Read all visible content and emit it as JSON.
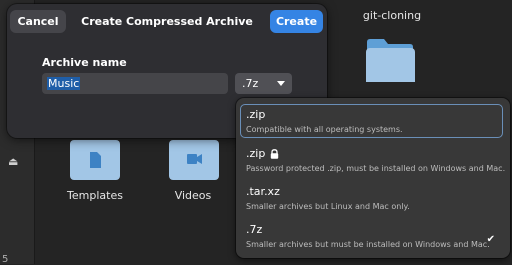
{
  "file_manager": {
    "items": [
      {
        "name": "git-cloning"
      },
      {
        "name": "Templates"
      },
      {
        "name": "Videos"
      }
    ],
    "eject_glyph": "⏏",
    "folder_color": "#a2c6e6",
    "folder_tab_color": "#5e9fd6"
  },
  "dialog": {
    "title": "Create Compressed Archive",
    "cancel_label": "Cancel",
    "create_label": "Create",
    "archive_name_label": "Archive name",
    "archive_name_value": "Music",
    "format_selected": ".7z"
  },
  "format_popover": {
    "options": [
      {
        "name": ".zip",
        "description": "Compatible with all operating systems.",
        "locked": false,
        "checked": false,
        "focused": true
      },
      {
        "name": ".zip",
        "description": "Password protected .zip, must be installed on Windows and Mac.",
        "locked": true,
        "checked": false,
        "focused": false
      },
      {
        "name": ".tar.xz",
        "description": "Smaller archives but Linux and Mac only.",
        "locked": false,
        "checked": false,
        "focused": false
      },
      {
        "name": ".7z",
        "description": "Smaller archives but must be installed on Windows and Mac.",
        "locked": false,
        "checked": true,
        "focused": false
      }
    ]
  },
  "colors": {
    "accent": "#3584e4",
    "background": "#242424",
    "dialog": "#2e2e32",
    "popover": "#383838"
  }
}
